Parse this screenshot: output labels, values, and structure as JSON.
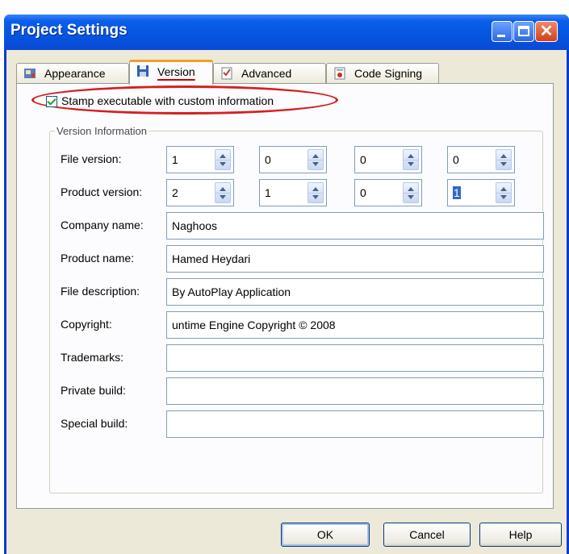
{
  "window": {
    "title": "Project Settings"
  },
  "tabs": [
    {
      "label": "Appearance",
      "icon": "appearance-icon"
    },
    {
      "label": "Version",
      "icon": "version-icon",
      "active": true
    },
    {
      "label": "Advanced",
      "icon": "checklist-icon"
    },
    {
      "label": "Code Signing",
      "icon": "certificate-icon"
    }
  ],
  "stamp": {
    "label": "Stamp executable with custom information",
    "checked": true
  },
  "group": {
    "legend": "Version Information"
  },
  "file_version": {
    "label": "File version:",
    "values": [
      "1",
      "0",
      "0",
      "0"
    ]
  },
  "product_version": {
    "label": "Product version:",
    "values": [
      "2",
      "1",
      "0",
      "1"
    ]
  },
  "fields": [
    {
      "label": "Company name:",
      "value": "Naghoos"
    },
    {
      "label": "Product name:",
      "value": "Hamed Heydari"
    },
    {
      "label": "File description:",
      "value": "By AutoPlay Application"
    },
    {
      "label": "Copyright:",
      "value": "untime Engine Copyright © 2008"
    },
    {
      "label": "Trademarks:",
      "value": ""
    },
    {
      "label": "Private build:",
      "value": ""
    },
    {
      "label": "Special build:",
      "value": ""
    }
  ],
  "buttons": {
    "ok": "OK",
    "cancel": "Cancel",
    "help": "Help"
  },
  "colors": {
    "titlebar": "#0555e0",
    "highlight_ellipse": "#d42020",
    "dialog_bg": "#ece9d8"
  }
}
